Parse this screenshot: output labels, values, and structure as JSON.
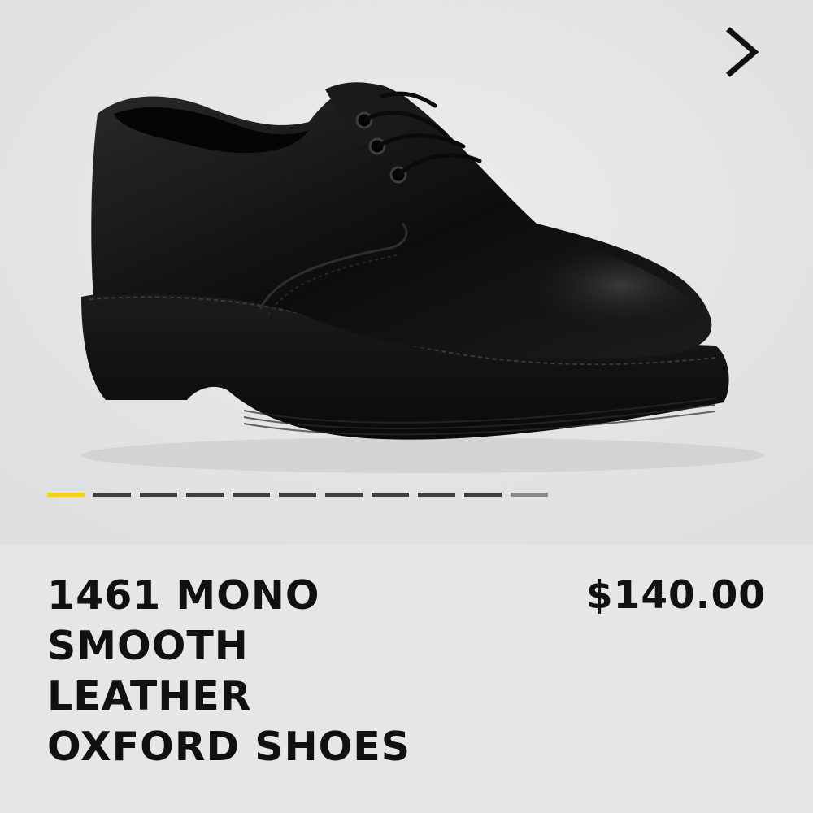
{
  "product": {
    "title": "1461 MONO\nSMOOTH\nLEATHER\nOXFORD SHOES",
    "price": "$140.00"
  },
  "gallery": {
    "image_count": 11,
    "active_index": 0,
    "next_icon": "chevron-right-icon",
    "colors": {
      "active_segment": "#f2d21b",
      "inactive_segment": "#3f3f3f",
      "partial_segment": "#8a8a8c"
    }
  }
}
